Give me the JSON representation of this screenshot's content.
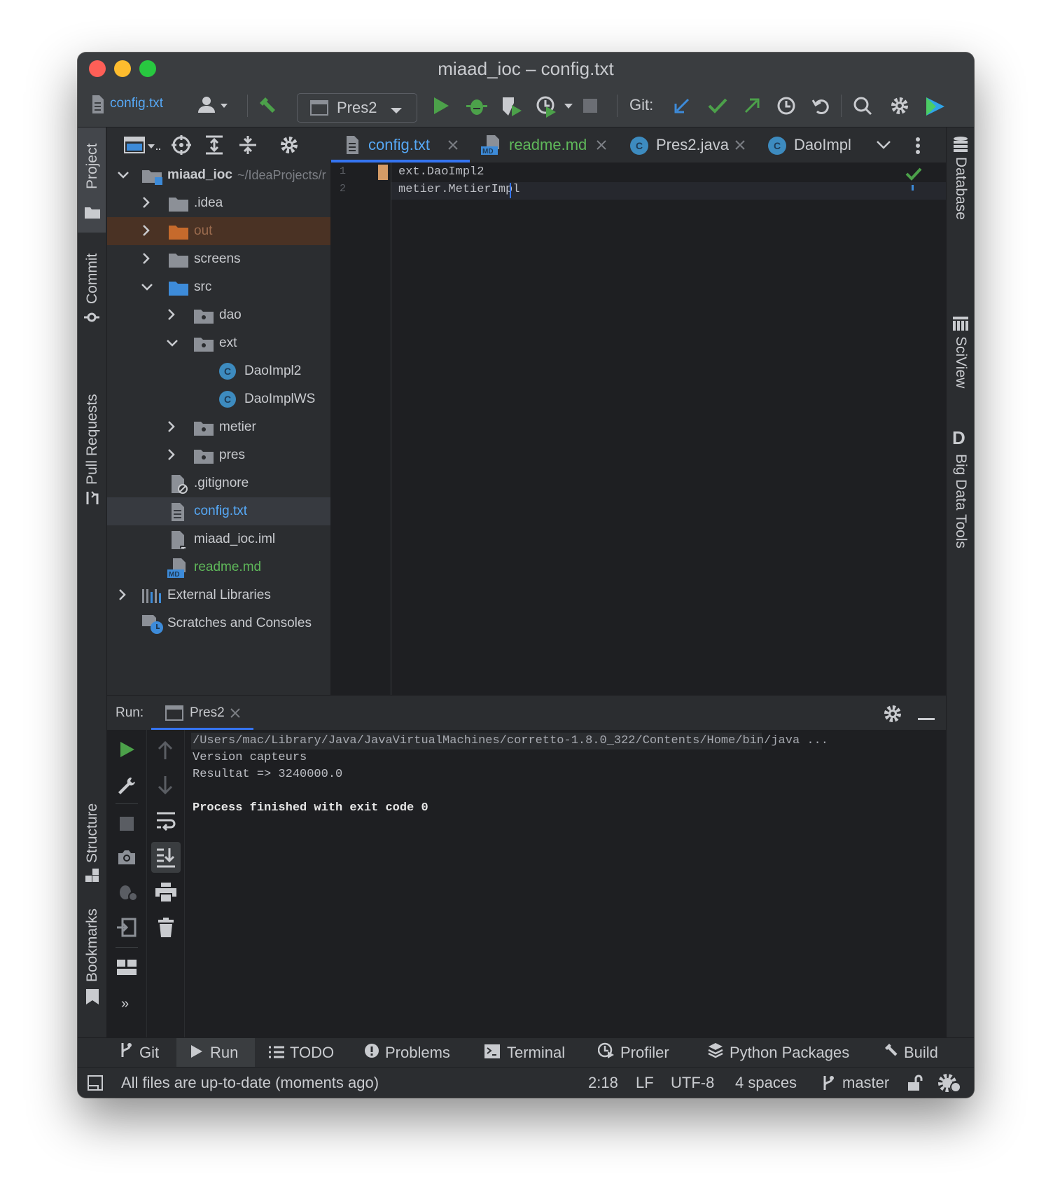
{
  "window": {
    "title": "miaad_ioc – config.txt"
  },
  "toolbar": {
    "breadcrumb_file": "config.txt",
    "run_config": "Pres2",
    "git_label": "Git:"
  },
  "left_strip": [
    "Project",
    "Commit",
    "Pull Requests",
    "Structure",
    "Bookmarks"
  ],
  "right_strip": [
    "Database",
    "SciView",
    "Big Data Tools"
  ],
  "project_tree": [
    {
      "label": "miaad_ioc",
      "suffix": "~/IdeaProjects/r",
      "level": 0,
      "kind": "module",
      "expanded": true
    },
    {
      "label": ".idea",
      "level": 1,
      "kind": "folder",
      "expanded": false
    },
    {
      "label": "out",
      "level": 1,
      "kind": "folder-excluded",
      "expanded": false
    },
    {
      "label": "screens",
      "level": 1,
      "kind": "folder",
      "expanded": false
    },
    {
      "label": "src",
      "level": 1,
      "kind": "folder-source",
      "expanded": true
    },
    {
      "label": "dao",
      "level": 2,
      "kind": "package",
      "expanded": false
    },
    {
      "label": "ext",
      "level": 2,
      "kind": "package",
      "expanded": true
    },
    {
      "label": "DaoImpl2",
      "level": 3,
      "kind": "class"
    },
    {
      "label": "DaoImplWS",
      "level": 3,
      "kind": "class"
    },
    {
      "label": "metier",
      "level": 2,
      "kind": "package",
      "expanded": false
    },
    {
      "label": "pres",
      "level": 2,
      "kind": "package",
      "expanded": false
    },
    {
      "label": ".gitignore",
      "level": 1,
      "kind": "file-ignore"
    },
    {
      "label": "config.txt",
      "level": 1,
      "kind": "file-text",
      "selected": true
    },
    {
      "label": "miaad_ioc.iml",
      "level": 1,
      "kind": "file-iml"
    },
    {
      "label": "readme.md",
      "level": 1,
      "kind": "file-md"
    },
    {
      "label": "External Libraries",
      "level": 0,
      "kind": "libraries",
      "expanded": false
    },
    {
      "label": "Scratches and Consoles",
      "level": 0,
      "kind": "scratches"
    }
  ],
  "editor_tabs": [
    {
      "label": "config.txt",
      "active": true
    },
    {
      "label": "readme.md"
    },
    {
      "label": "Pres2.java"
    },
    {
      "label": "DaoImpl"
    }
  ],
  "editor": {
    "line_numbers": [
      "1",
      "2"
    ],
    "lines": [
      "ext.DaoImpl2",
      "metier.MetierImpl"
    ]
  },
  "run_panel": {
    "label": "Run:",
    "tab": "Pres2",
    "output": [
      "/Users/mac/Library/Java/JavaVirtualMachines/corretto-1.8.0_322/Contents/Home/bin/java ...",
      "Version capteurs",
      "Resultat => 3240000.0",
      "",
      "Process finished with exit code 0"
    ]
  },
  "bottom_tools": [
    "Git",
    "Run",
    "TODO",
    "Problems",
    "Terminal",
    "Profiler",
    "Python Packages",
    "Build"
  ],
  "status_bar": {
    "message": "All files are up-to-date (moments ago)",
    "position": "2:18",
    "line_sep": "LF",
    "encoding": "UTF-8",
    "indent": "4 spaces",
    "branch": "master"
  },
  "colors": {
    "accent": "#3574f0",
    "green": "#4ca14a",
    "excluded_folder": "#c66a2c",
    "md_file": "#5fb85a",
    "selected_file": "#56a8f5"
  }
}
